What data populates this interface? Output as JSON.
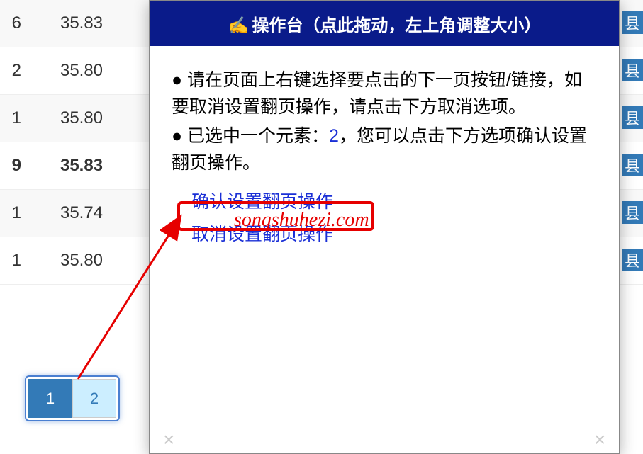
{
  "table": {
    "rows": [
      {
        "col1": "6",
        "col2": "35.83",
        "bold": false
      },
      {
        "col1": "2",
        "col2": "35.80",
        "bold": false
      },
      {
        "col1": "1",
        "col2": "35.80",
        "bold": false
      },
      {
        "col1": "9",
        "col2": "35.83",
        "bold": true
      },
      {
        "col1": "1",
        "col2": "35.74",
        "bold": false
      },
      {
        "col1": "1",
        "col2": "35.80",
        "bold": false
      }
    ],
    "badge_text": "县"
  },
  "pagination": {
    "pages": [
      "1",
      "2"
    ],
    "active": "1",
    "highlighted": "2"
  },
  "dialog": {
    "hand_icon": "✍️",
    "title": "操作台（点此拖动，左上角调整大小）",
    "bullet1": "● 请在页面上右键选择要点击的下一页按钮/链接，如要取消设置翻页操作，请点击下方取消选项。",
    "bullet2_prefix": "● 已选中一个元素：",
    "selected_element": "2",
    "bullet2_suffix": "，您可以点击下方选项确认设置翻页操作。",
    "confirm_label": "确认设置翻页操作",
    "cancel_label": "取消设置翻页操作"
  },
  "watermark": "songshuhezi.com",
  "close_icon": "×"
}
